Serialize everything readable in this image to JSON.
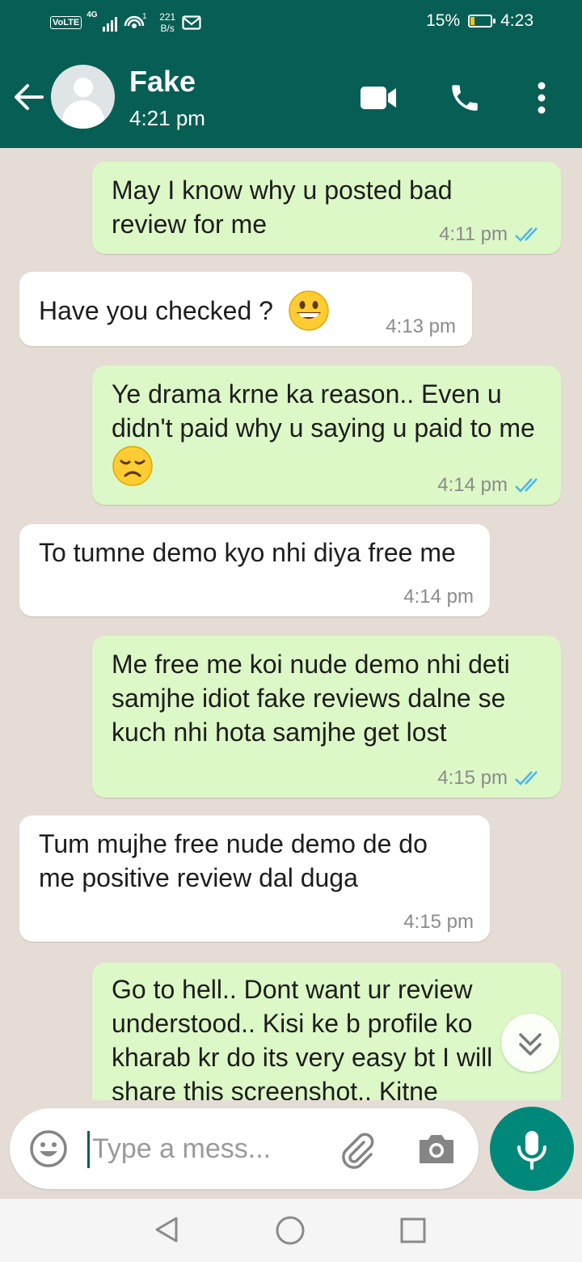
{
  "status_bar": {
    "volte": "VoLTE",
    "network": "4G",
    "speed_value": "221",
    "speed_unit": "B/s",
    "wifi_count": "1",
    "battery": "15%",
    "time": "4:23"
  },
  "header": {
    "name": "Fake",
    "subtitle": "4:21 pm"
  },
  "messages": [
    {
      "direction": "out",
      "text": "May I know why u posted bad review for me",
      "time": "4:11 pm",
      "read": true
    },
    {
      "direction": "in",
      "text": "Have you checked ?",
      "emoji": "grinning-face",
      "time": "4:13 pm"
    },
    {
      "direction": "out",
      "text": "Ye drama krne ka reason.. Even u didn't paid why u saying u paid to me",
      "emoji": "disappointed-face",
      "time": "4:14 pm",
      "read": true
    },
    {
      "direction": "in",
      "text": "To tumne demo kyo nhi diya free me",
      "time": "4:14 pm"
    },
    {
      "direction": "out",
      "text": "Me free me koi nude demo nhi deti samjhe idiot fake reviews dalne se kuch nhi hota samjhe get lost",
      "time": "4:15 pm",
      "read": true
    },
    {
      "direction": "in",
      "text": "Tum mujhe free nude demo de do me positive review dal duga",
      "time": "4:15 pm"
    },
    {
      "direction": "out",
      "text": "Go to hell.. Dont want ur review understood.. Kisi ke b profile ko kharab kr do its very easy bt I will share this screenshot.. Kitne"
    }
  ],
  "composer": {
    "placeholder": "Type a mess..."
  },
  "colors": {
    "header": "#075e54",
    "outgoing_bubble": "#dcf8c6",
    "incoming_bubble": "#ffffff",
    "read_tick": "#4fb6ec",
    "mic_button": "#00897b"
  }
}
